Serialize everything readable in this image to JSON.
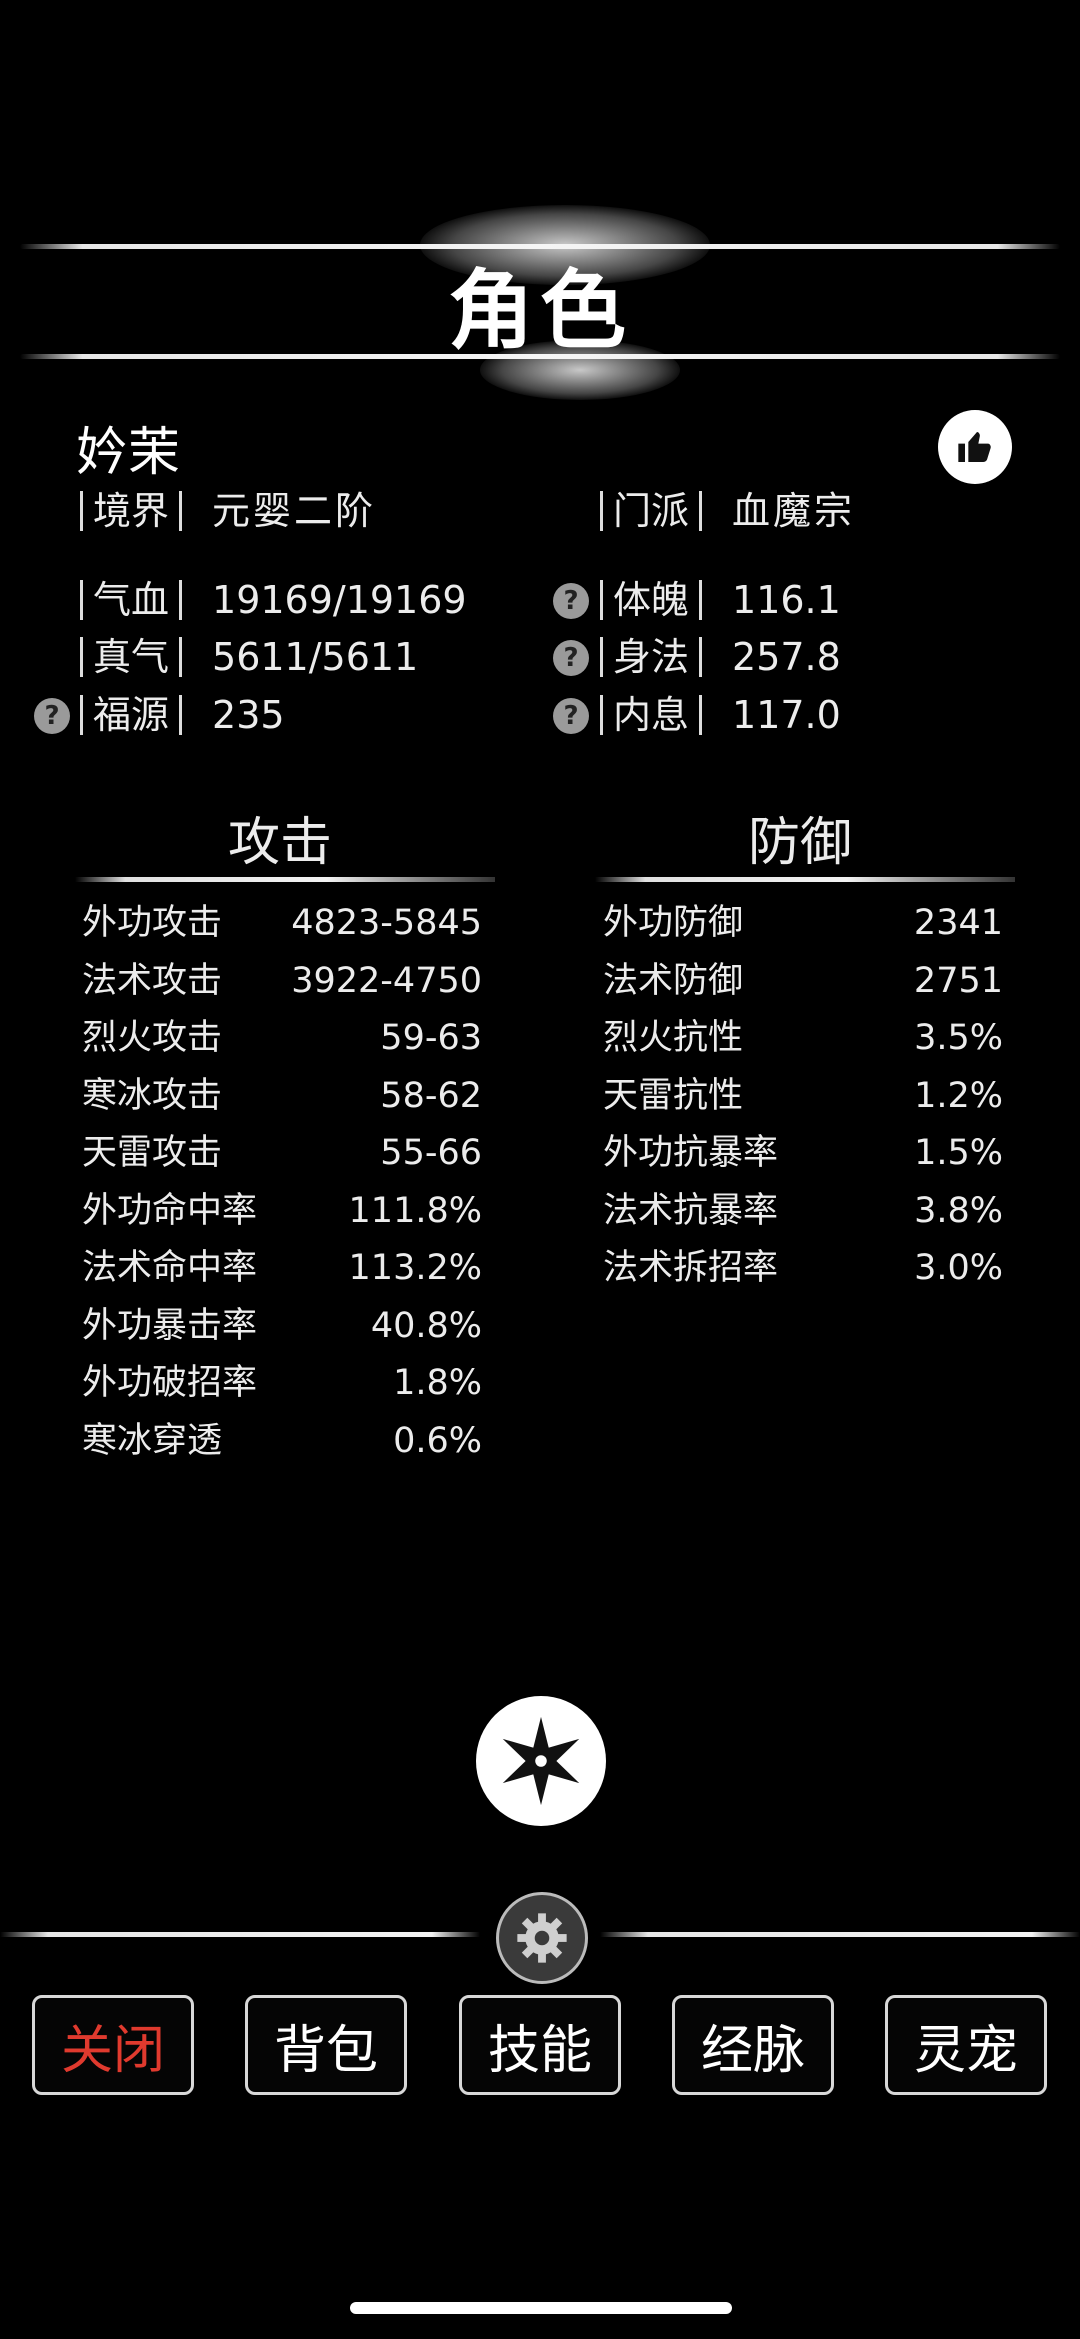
{
  "title": "角色",
  "character": {
    "name": "妗茉",
    "realm_label": "境界",
    "realm_value": "元婴二阶",
    "sect_label": "门派",
    "sect_value": "血魔宗"
  },
  "attributes_left": [
    {
      "label": "气血",
      "value": "19169/19169",
      "help": false
    },
    {
      "label": "真气",
      "value": "5611/5611",
      "help": false
    },
    {
      "label": "福源",
      "value": "235",
      "help": true
    }
  ],
  "attributes_right": [
    {
      "label": "体魄",
      "value": "116.1",
      "help": true
    },
    {
      "label": "身法",
      "value": "257.8",
      "help": true
    },
    {
      "label": "内息",
      "value": "117.0",
      "help": true
    }
  ],
  "attack": {
    "title": "攻击",
    "stats": [
      {
        "name": "外功攻击",
        "value": "4823-5845"
      },
      {
        "name": "法术攻击",
        "value": "3922-4750"
      },
      {
        "name": "烈火攻击",
        "value": "59-63"
      },
      {
        "name": "寒冰攻击",
        "value": "58-62"
      },
      {
        "name": "天雷攻击",
        "value": "55-66"
      },
      {
        "name": "外功命中率",
        "value": "111.8%"
      },
      {
        "name": "法术命中率",
        "value": "113.2%"
      },
      {
        "name": "外功暴击率",
        "value": "40.8%"
      },
      {
        "name": "外功破招率",
        "value": "1.8%"
      },
      {
        "name": "寒冰穿透",
        "value": "0.6%"
      }
    ]
  },
  "defense": {
    "title": "防御",
    "stats": [
      {
        "name": "外功防御",
        "value": "2341"
      },
      {
        "name": "法术防御",
        "value": "2751"
      },
      {
        "name": "烈火抗性",
        "value": "3.5%"
      },
      {
        "name": "天雷抗性",
        "value": "1.2%"
      },
      {
        "name": "外功抗暴率",
        "value": "1.5%"
      },
      {
        "name": "法术抗暴率",
        "value": "3.8%"
      },
      {
        "name": "法术拆招率",
        "value": "3.0%"
      }
    ]
  },
  "tabs": [
    {
      "label": "关闭",
      "active": true
    },
    {
      "label": "背包",
      "active": false
    },
    {
      "label": "技能",
      "active": false
    },
    {
      "label": "经脉",
      "active": false
    },
    {
      "label": "灵宠",
      "active": false
    }
  ],
  "colors": {
    "accent_red": "#e03a2e",
    "background": "#000000",
    "text": "#ececec"
  }
}
